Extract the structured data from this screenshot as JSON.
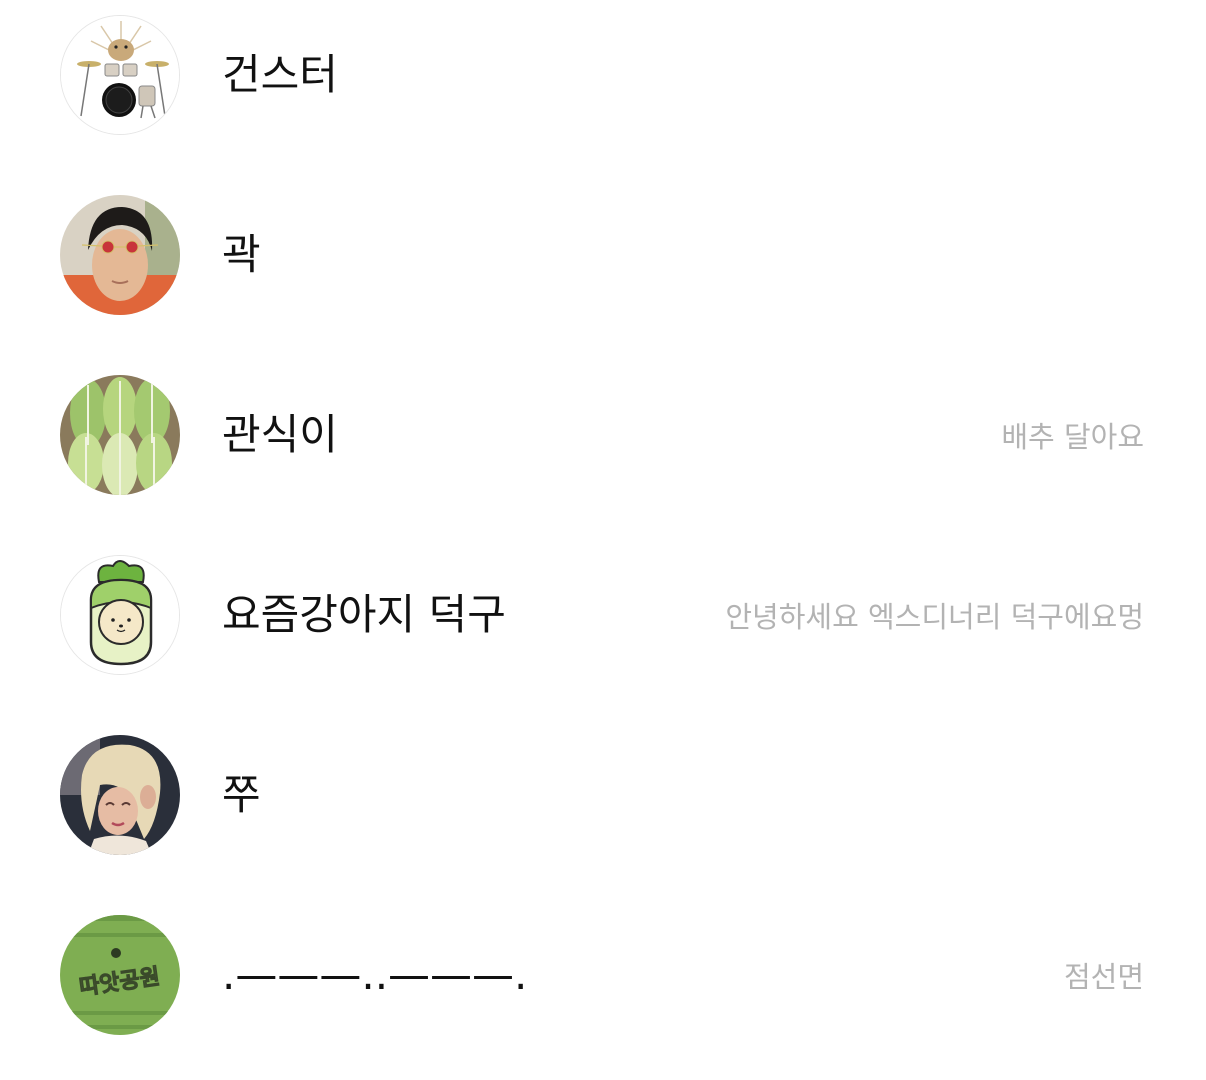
{
  "friends": [
    {
      "name": "건스터",
      "status": "",
      "avatar_icon": "drum-kit-icon"
    },
    {
      "name": "곽",
      "status": "",
      "avatar_icon": "person-selfie-icon"
    },
    {
      "name": "관식이",
      "status": "배추 달아요",
      "avatar_icon": "napa-cabbage-icon"
    },
    {
      "name": "요즘강아지 덕구",
      "status": "안녕하세요 엑스디너리 덕구에요멍",
      "avatar_icon": "radish-character-icon"
    },
    {
      "name": "쭈",
      "status": "",
      "avatar_icon": "blonde-person-icon"
    },
    {
      "name": ".———..———.",
      "status": "점선면",
      "avatar_icon": "park-sign-icon",
      "avatar_text": "따앗공원"
    }
  ],
  "colors": {
    "name_text": "#111111",
    "status_text": "#b3b3b3",
    "background": "#ffffff"
  }
}
